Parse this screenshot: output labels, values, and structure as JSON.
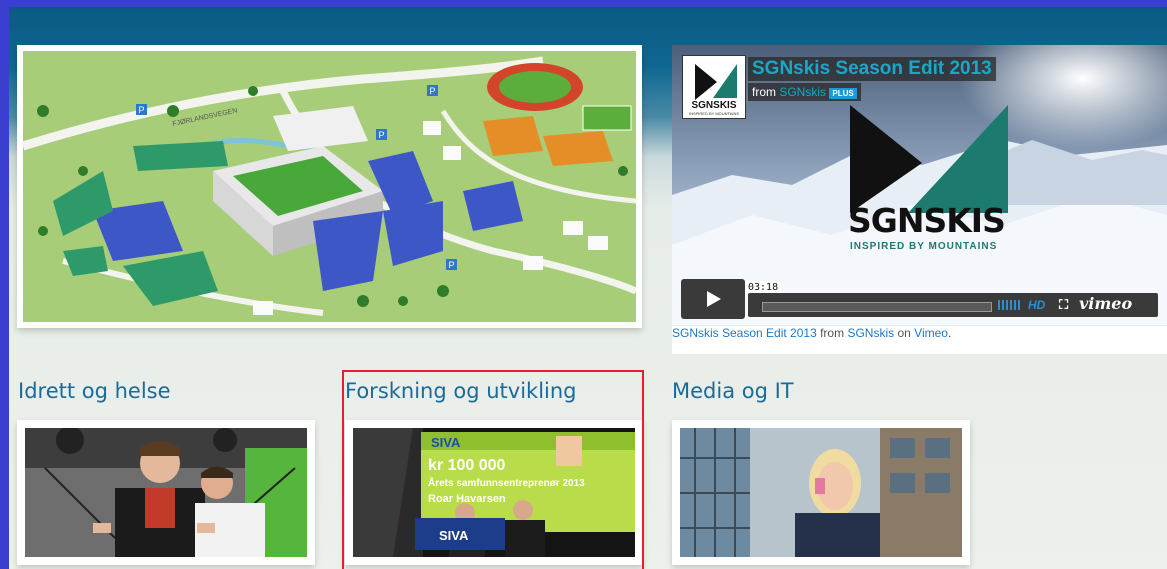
{
  "video": {
    "title": "SGNskis Season Edit 2013",
    "from_label": "from",
    "from_channel": "SGNskis",
    "plus_badge": "PLUS",
    "logo_small_text": "SGNSKIS",
    "logo_small_tagline": "INSPIRED BY MOUNTAINS",
    "brand_name": "SGNSKIS",
    "brand_tagline": "INSPIRED BY MOUNTAINS",
    "duration": "03:18",
    "hd_label": "HD",
    "vimeo_label": "vimeo",
    "progress_fraction": 0.0
  },
  "caption": {
    "title": "SGNskis Season Edit 2013",
    "from": "from",
    "channel": "SGNskis",
    "on": "on",
    "platform": "Vimeo",
    "period": "."
  },
  "sections": [
    {
      "title": "Idrett og helse"
    },
    {
      "title": "Forskning og utvikling"
    },
    {
      "title": "Media og IT"
    }
  ],
  "map": {
    "road_label": "FJØRLANDSVEGEN",
    "parking_label": "P"
  },
  "research_photo": {
    "logo_text": "SIVA",
    "amount": "kr 100 000",
    "subtitle": "Årets samfunnsentreprenør 2013",
    "name": "Roar Havarsen"
  },
  "colors": {
    "accent": "#1a6a9a",
    "link": "#1f77c9",
    "highlight": "#e2212b",
    "brand_teal": "#1d7a6e"
  }
}
